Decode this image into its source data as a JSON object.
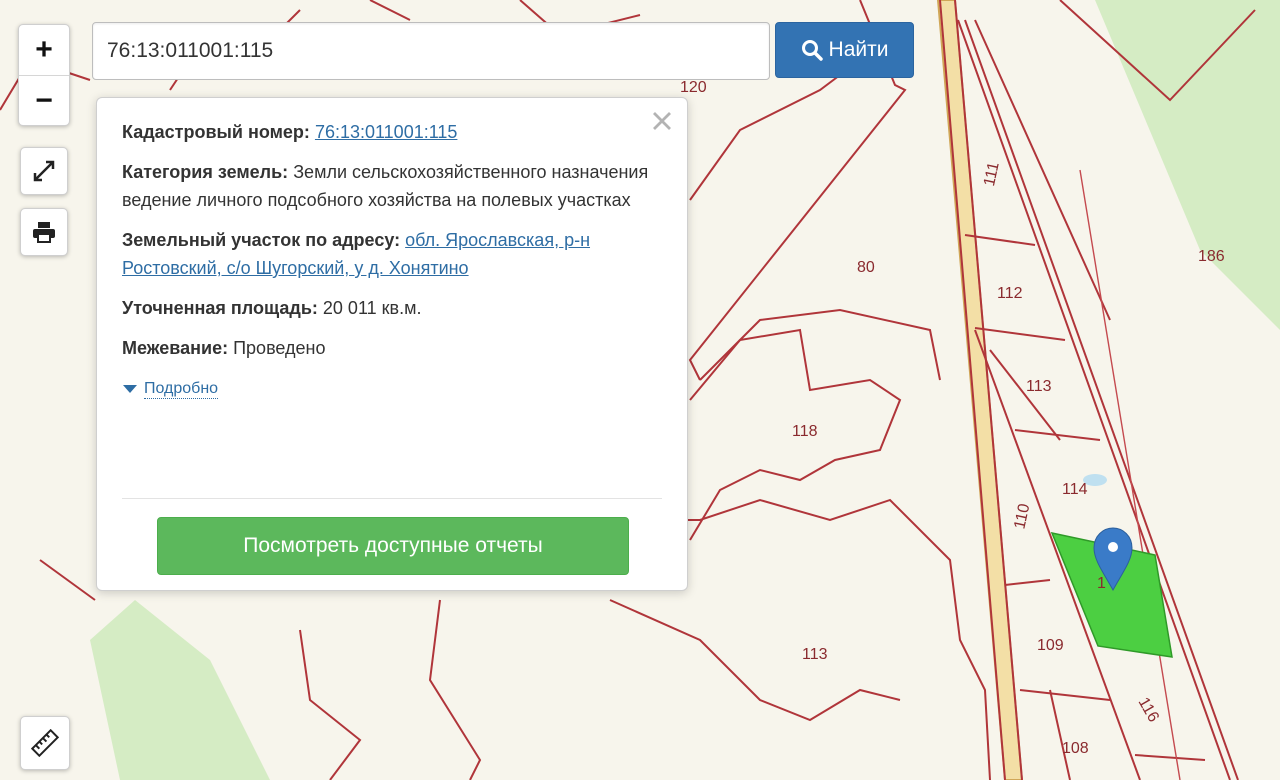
{
  "search": {
    "value": "76:13:011001:115",
    "button_label": "Найти",
    "button_icon": "search-icon"
  },
  "controls": {
    "zoom_in": "+",
    "zoom_out": "−",
    "fullscreen_icon": "expand-icon",
    "print_icon": "printer-icon",
    "ruler_icon": "ruler-icon"
  },
  "popup": {
    "cadastral_label": "Кадастровый номер:",
    "cadastral_value": "76:13:011001:115",
    "category_label": "Категория земель:",
    "category_value_1": "Земли сельскохозяйственного назначения",
    "category_value_2": "ведение личного подсобного хозяйства на полевых участках",
    "address_label": "Земельный участок по адресу:",
    "address_value": "обл. Ярославская, р-н Ростовский, с/о Шугорский, у д. Хонятино",
    "area_label": "Уточненная площадь:",
    "area_value": "20 011 кв.м.",
    "survey_label": "Межевание:",
    "survey_value": "Проведено",
    "details_label": "Подробно",
    "reports_button": "Посмотреть доступные отчеты",
    "close_icon": "close-icon"
  },
  "map": {
    "plot_labels": [
      "120",
      "111",
      "186",
      "80",
      "112",
      "113",
      "118",
      "114",
      "110",
      "1",
      "109",
      "113",
      "116",
      "108"
    ],
    "colors": {
      "background": "#f7f5ec",
      "parcel_border": "#b0353a",
      "green_area": "#d5ecc4",
      "selected_plot": "#4ccf42",
      "road": "#f3dfa6",
      "marker": "#3a7bc8"
    }
  }
}
